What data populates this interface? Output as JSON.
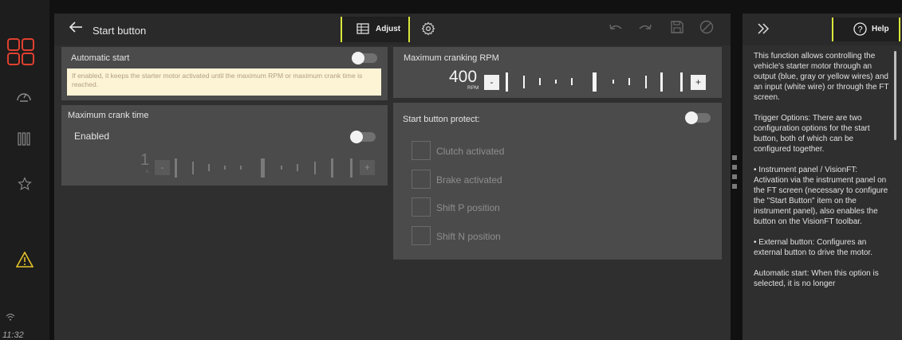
{
  "time": "11:32",
  "header": {
    "title": "Start button",
    "adjust_label": "Adjust"
  },
  "automatic_start": {
    "label": "Automatic start",
    "toggle": "off",
    "hint": "If enabled, it keeps the starter motor activated until the maximum RPM or maximum crank time is reached."
  },
  "max_cranking_rpm": {
    "label": "Maximum cranking RPM",
    "value": "400",
    "unit": "RPM",
    "minus_label": "-",
    "plus_label": "+"
  },
  "max_crank_time": {
    "label": "Maximum crank time",
    "enabled_label": "Enabled",
    "toggle": "off",
    "value": "1",
    "unit": "s",
    "minus_label": "-",
    "plus_label": "+"
  },
  "start_button_protect": {
    "label": "Start button protect:",
    "toggle": "off",
    "options": [
      {
        "label": "Clutch activated",
        "checked": false
      },
      {
        "label": "Brake activated",
        "checked": false
      },
      {
        "label": "Shift P position",
        "checked": false
      },
      {
        "label": "Shift N position",
        "checked": false
      }
    ]
  },
  "help": {
    "button_label": "Help",
    "paragraphs": [
      "This function allows controlling the vehicle's starter motor through an output (blue, gray or yellow wires) and an input (white wire) or through the FT screen.",
      "Trigger Options: There are two configuration options for the start button, both of which can be configured together.",
      "• Instrument panel / VisionFT: Activation via the instrument panel on the FT screen (necessary to configure the \"Start Button\" item on the instrument panel), also enables the button on the VisionFT toolbar.",
      "• External button: Configures an external button to drive the motor.",
      "Automatic start: When this option is selected, it is no longer"
    ]
  },
  "colors": {
    "accent": "#d9e83a",
    "warning": "#e3c32a",
    "brand_red": "#e0402f"
  },
  "icons": [
    "grid-icon",
    "dashboard-gauge-icon",
    "columns-icon",
    "star-icon",
    "warning-icon",
    "wifi-icon",
    "back-arrow-icon",
    "table-icon",
    "gear-icon",
    "undo-icon",
    "redo-icon",
    "save-icon",
    "cancel-icon",
    "expand-icon",
    "help-icon"
  ]
}
